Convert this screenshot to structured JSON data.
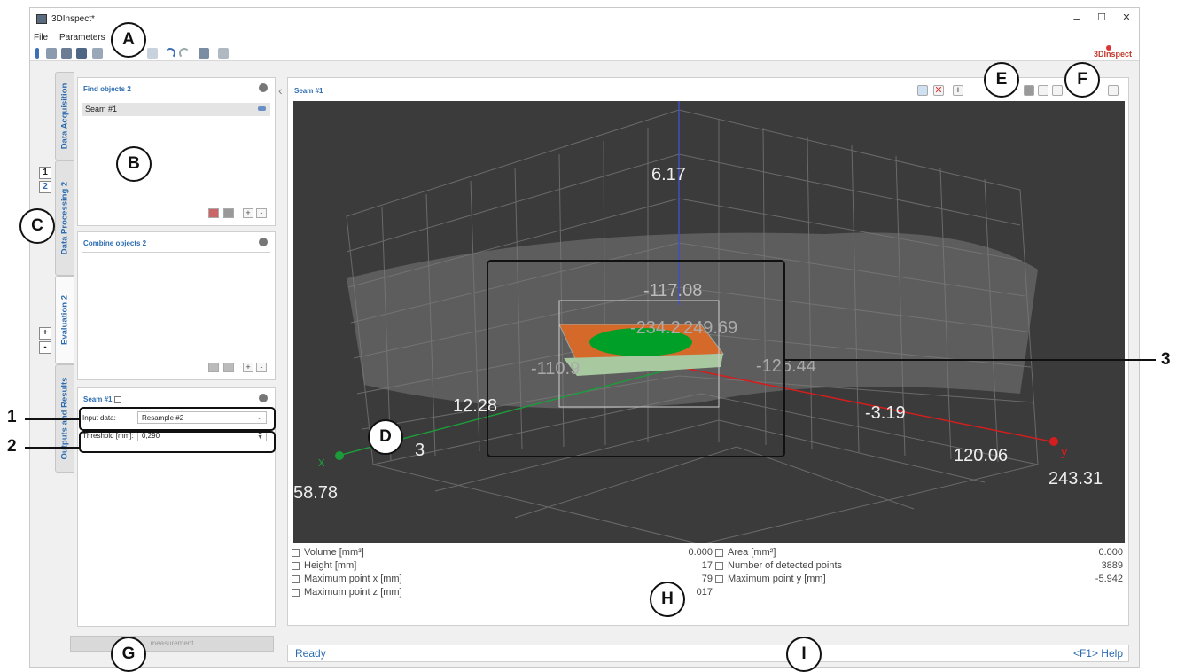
{
  "app": {
    "title": "3DInspect*",
    "brand": "3DInspect",
    "minimize": "–",
    "maximize": "☐",
    "close": "✕"
  },
  "menu": {
    "file": "File",
    "parameters": "Parameters"
  },
  "tabs": [
    "Data Acquisition",
    "Data Processing 2",
    "Evaluation 2",
    "Outputs and Results"
  ],
  "evaluation_numbers": {
    "one": "1",
    "two": "2",
    "plus": "+",
    "minus": "-"
  },
  "find_panel": {
    "title": "Find objects 2",
    "items": [
      "Seam #1"
    ],
    "add": "+",
    "remove": "-"
  },
  "combine_panel": {
    "title": "Combine objects 2",
    "add": "+",
    "remove": "-"
  },
  "seam_panel": {
    "title": "Seam #1",
    "input_label": "Input data:",
    "input_value": "Resample #2",
    "threshold_label": "Threshold [mm]:",
    "threshold_value": "0,290"
  },
  "view": {
    "title": "Seam #1",
    "plot_labels": {
      "z_top": "6.17",
      "z_mid": "-117.08",
      "center_a": "-234.2",
      "center_b": "249.69",
      "x_neg": "-110.9",
      "x_mid": "12.28",
      "y_neg": "-126.44",
      "y_mid": "-3.19",
      "y_far": "120.06",
      "y_end": "243.31",
      "x_end": "58.78",
      "x_low": "3",
      "x_axis": "x",
      "y_axis": "y"
    },
    "colors": {
      "background": "#3b3b3b",
      "seam": "#00a028",
      "surface": "#d4692a",
      "x_axis": "#1d9a3a",
      "y_axis": "#d21e1e"
    }
  },
  "results": {
    "left": [
      {
        "label": "Volume [mm³]",
        "value": "0.000"
      },
      {
        "label": "Height [mm]",
        "value": "17"
      },
      {
        "label": "Maximum point x [mm]",
        "value": "79"
      },
      {
        "label": "Maximum point z [mm]",
        "value": "017"
      }
    ],
    "right": [
      {
        "label": "Area [mm²]",
        "value": "0.000"
      },
      {
        "label": "Number of detected points",
        "value": "3889"
      },
      {
        "label": "Maximum point y [mm]",
        "value": "-5.942"
      }
    ]
  },
  "start_button": "measurement",
  "status": {
    "text": "Ready",
    "help": "<F1> Help"
  },
  "annotations": {
    "A": "A",
    "B": "B",
    "C": "C",
    "D": "D",
    "E": "E",
    "F": "F",
    "G": "G",
    "H": "H",
    "I": "I",
    "n1": "1",
    "n2": "2",
    "n3": "3"
  }
}
